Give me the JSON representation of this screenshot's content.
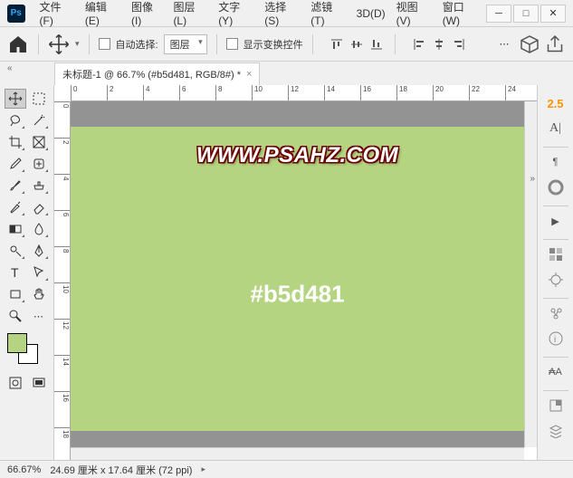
{
  "app": {
    "logo": "Ps"
  },
  "menu": [
    "文件(F)",
    "编辑(E)",
    "图像(I)",
    "图层(L)",
    "文字(Y)",
    "选择(S)",
    "滤镜(T)",
    "3D(D)",
    "视图(V)",
    "窗口(W)"
  ],
  "options": {
    "auto_select_label": "自动选择:",
    "auto_select_target": "图层",
    "show_transform_label": "显示变换控件"
  },
  "tab": {
    "title": "未标题-1 @ 66.7% (#b5d481, RGB/8#) *"
  },
  "ruler_h": [
    "0",
    "2",
    "4",
    "6",
    "8",
    "10",
    "12",
    "14",
    "16",
    "18",
    "20",
    "22",
    "24"
  ],
  "ruler_v": [
    "0",
    "2",
    "4",
    "6",
    "8",
    "10",
    "12",
    "14",
    "16",
    "18"
  ],
  "canvas": {
    "bg": "#b5d481",
    "watermark": "WWW.PSAHZ.COM",
    "hex_label": "#b5d481"
  },
  "right_brush": "2.5",
  "status": {
    "zoom": "66.67%",
    "doc": "24.69 厘米 x 17.64 厘米 (72 ppi)"
  }
}
